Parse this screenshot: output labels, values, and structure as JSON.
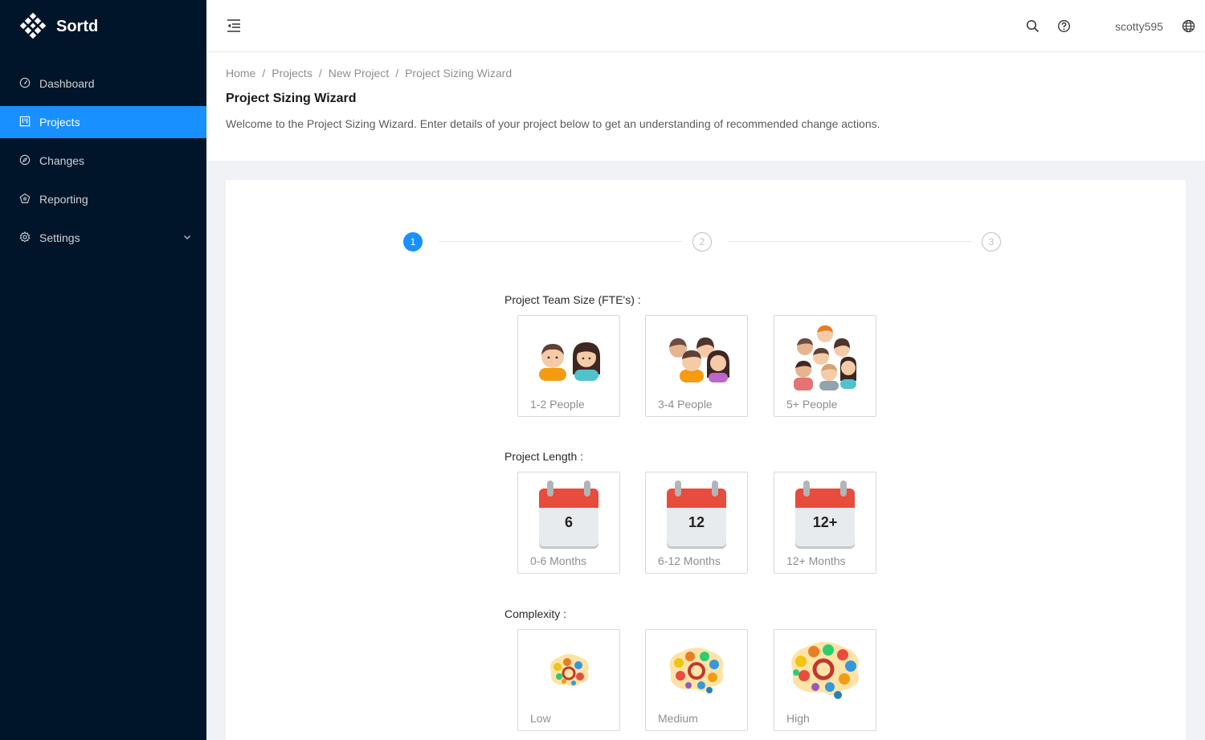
{
  "app": {
    "name": "Sortd"
  },
  "sidebar": {
    "items": [
      {
        "label": "Dashboard",
        "icon": "dashboard-icon"
      },
      {
        "label": "Projects",
        "icon": "project-icon",
        "active": true
      },
      {
        "label": "Changes",
        "icon": "compass-icon"
      },
      {
        "label": "Reporting",
        "icon": "chart-icon"
      },
      {
        "label": "Settings",
        "icon": "gear-icon",
        "has_submenu": true
      }
    ]
  },
  "header": {
    "username": "scotty595"
  },
  "breadcrumb": [
    "Home",
    "Projects",
    "New Project",
    "Project Sizing Wizard"
  ],
  "page": {
    "title": "Project Sizing Wizard",
    "description": "Welcome to the Project Sizing Wizard. Enter details of your project below to get an understanding of recommended change actions."
  },
  "steps": {
    "labels": [
      "1",
      "2",
      "3"
    ],
    "current": 1
  },
  "sections": {
    "team_size": {
      "label": "Project Team Size (FTE's)",
      "options": [
        "1-2 People",
        "3-4 People",
        "5+ People"
      ]
    },
    "length": {
      "label": "Project Length",
      "options": [
        "0-6 Months",
        "6-12 Months",
        "12+ Months"
      ],
      "calendar_numbers": [
        "6",
        "12",
        "12+"
      ]
    },
    "complexity": {
      "label": "Complexity",
      "options": [
        "Low",
        "Medium",
        "High"
      ]
    }
  },
  "colors": {
    "sidebar_bg": "#001529",
    "accent": "#1890ff",
    "calendar_red": "#e74c3c"
  }
}
